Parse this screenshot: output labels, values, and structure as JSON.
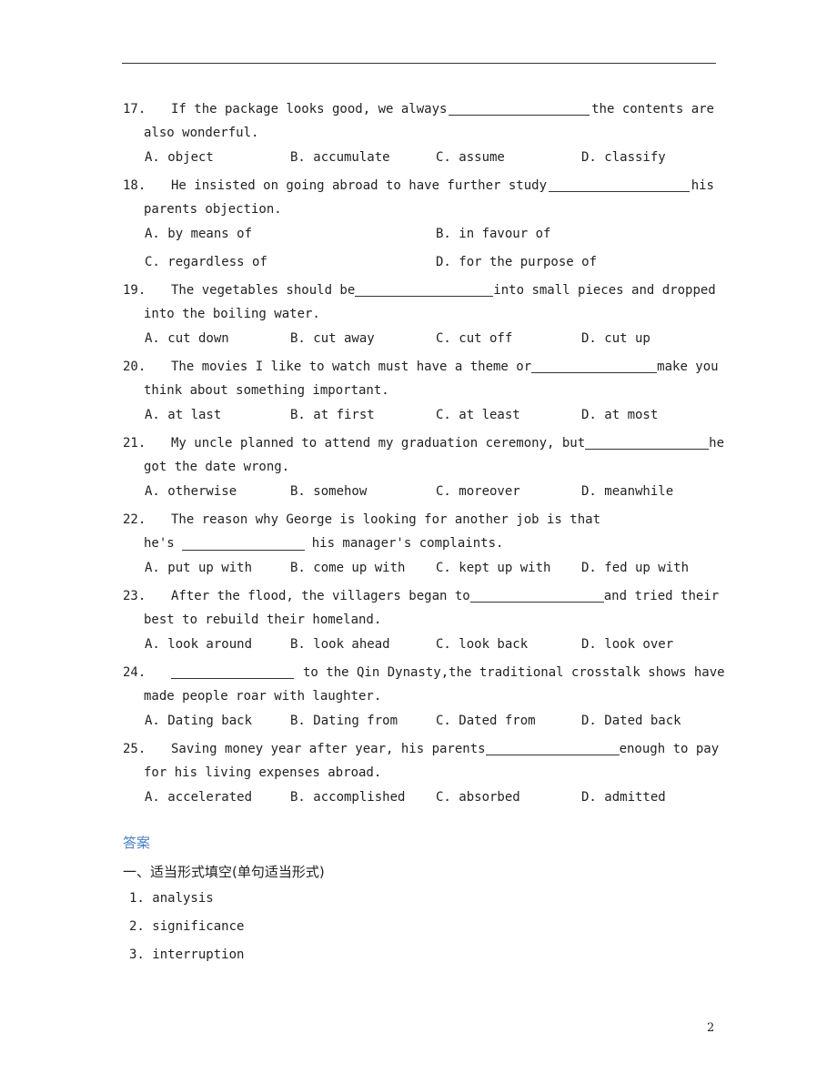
{
  "questions": [
    {
      "num": "17.",
      "pre": "If the package looks good, we always",
      "post": "the contents are",
      "cont": "also wonderful.",
      "options": [
        "A. object",
        "B. accumulate",
        "C. assume",
        "D. classify"
      ],
      "two_col": false
    },
    {
      "num": "18.",
      "pre": "He insisted on going abroad to have further study",
      "post": "his",
      "cont": "parents objection.",
      "options": [
        "A. by means of",
        "B. in favour of",
        "C. regardless of",
        "D. for the purpose of"
      ],
      "two_col": true
    },
    {
      "num": "19.",
      "pre": "The vegetables should be",
      "post": "into small pieces and dropped",
      "cont": "into the boiling water.",
      "options": [
        "A. cut down",
        "B. cut away",
        "C. cut off",
        "D. cut up"
      ],
      "two_col": false
    },
    {
      "num": "20.",
      "pre": "The movies I like to watch must have a theme or",
      "post": "make you",
      "cont": "think about something important.",
      "options": [
        "A. at last",
        "B. at first",
        "C. at least",
        "D. at most"
      ],
      "two_col": false
    },
    {
      "num": "21.",
      "pre": "My uncle planned to attend my graduation ceremony, but",
      "post": "he",
      "cont": "got the date wrong.",
      "options": [
        "A. otherwise",
        "B. somehow",
        "C. moreover",
        "D. meanwhile"
      ],
      "two_col": false
    },
    {
      "num": "22.",
      "pre": "The reason why George is looking for another job is that",
      "post": "",
      "cont_pre": "he's",
      "cont_post": "his manager's complaints.",
      "options": [
        "A. put up with",
        "B. come up with",
        "C. kept up with",
        "D. fed up with"
      ],
      "two_col": false
    },
    {
      "num": "23.",
      "pre": "After the flood, the villagers began to",
      "post": "and tried their",
      "cont": "best to rebuild their homeland.",
      "options": [
        "A. look around",
        "B. look ahead",
        "C. look back",
        "D. look over"
      ],
      "two_col": false
    },
    {
      "num": "24.",
      "pre": "",
      "post": "to the Qin Dynasty,the traditional crosstalk shows have",
      "cont": "made people roar with laughter.",
      "options": [
        "A. Dating back",
        "B. Dating from",
        "C. Dated from",
        "D. Dated back"
      ],
      "two_col": false
    },
    {
      "num": "25.",
      "pre": "Saving money year after year, his parents",
      "post": "enough to pay",
      "cont": "for his living expenses abroad.",
      "options": [
        "A. accelerated",
        "B. accomplished",
        "C. absorbed",
        "D. admitted"
      ],
      "two_col": false
    }
  ],
  "answers": {
    "title": "答案",
    "section": "一、适当形式填空(单句适当形式)",
    "items": [
      "1. analysis",
      "2. significance",
      "3. interruption"
    ]
  },
  "page_number": "2"
}
